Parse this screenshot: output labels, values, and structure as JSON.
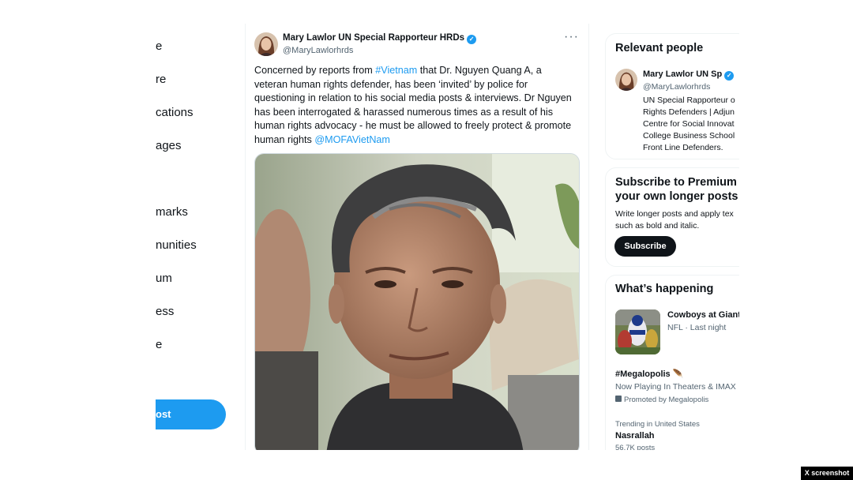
{
  "left_nav": {
    "items": [
      {
        "label": "e"
      },
      {
        "label": "re"
      },
      {
        "label": "cations"
      },
      {
        "label": "ages"
      },
      {
        "label": ""
      },
      {
        "label": "marks"
      },
      {
        "label": "nunities"
      },
      {
        "label": "um"
      },
      {
        "label": "ess"
      },
      {
        "label": "e"
      }
    ],
    "post_label": "ost",
    "accent_color": "#1d9bf0"
  },
  "tweet": {
    "author_name": "Mary Lawlor UN Special Rapporteur HRDs",
    "author_handle": "@MaryLawlorhrds",
    "verified_icon": "verified-badge-icon",
    "more_icon": "more-icon",
    "text_1": "Concerned by reports from ",
    "hashtag": "#Vietnam",
    "text_2": " that Dr. Nguyen Quang A, a veteran human rights defender, has been ‘invited’ by police for questioning in relation to his social media posts & interviews. Dr Nguyen has been interrogated & harassed numerous times as a result of his human rights advocacy - he must be allowed to freely protect & promote human rights ",
    "mention": "@MOFAVietNam",
    "link_color": "#1d9bf0"
  },
  "right": {
    "relevant": {
      "title": "Relevant people",
      "name": "Mary Lawlor UN Sp",
      "handle": "@MaryLawlorhrds",
      "bio_lines": [
        "UN Special Rapporteur o",
        "Rights Defenders | Adjun",
        "Centre for Social Innovat",
        "College Business School",
        "Front Line Defenders."
      ]
    },
    "premium": {
      "title_line_1": "Subscribe to Premium",
      "title_line_2": "your own longer posts",
      "desc_line_1": "Write longer posts and apply tex",
      "desc_line_2": "such as bold and italic.",
      "button": "Subscribe"
    },
    "happening": {
      "title": "What’s happening",
      "item1_title": "Cowboys at Giant",
      "item1_meta": "NFL · Last night",
      "item2_title": "#Megalopolis 🪶",
      "item2_sub": "Now Playing In Theaters & IMAX",
      "item2_promo": "Promoted by Megalopolis",
      "item3_meta": "Trending in United States",
      "item3_title": "Nasrallah",
      "item3_count": "56.7K posts"
    }
  },
  "caption": "X screenshot"
}
